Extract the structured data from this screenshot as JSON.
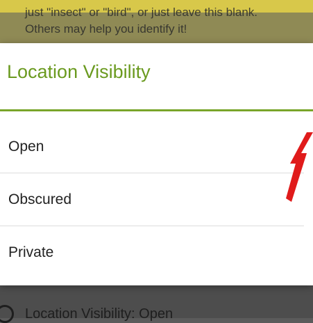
{
  "background": {
    "hint_line1": "just \"insect\" or \"bird\", or just leave this blank.",
    "hint_line2": "Others may help you identify it!",
    "bottom_label": "Location Visibility: Open"
  },
  "dialog": {
    "title": "Location Visibility",
    "options": [
      {
        "label": "Open"
      },
      {
        "label": "Obscured"
      },
      {
        "label": "Private"
      }
    ]
  },
  "colors": {
    "accent": "#79a52a",
    "title": "#6a9a1f",
    "annotation_arrow": "#e01b1b",
    "top_strip": "#d8c84a"
  },
  "icons": {
    "bottom_row_icon": "location-visibility-icon",
    "annotation": "red-arrow-annotation"
  }
}
